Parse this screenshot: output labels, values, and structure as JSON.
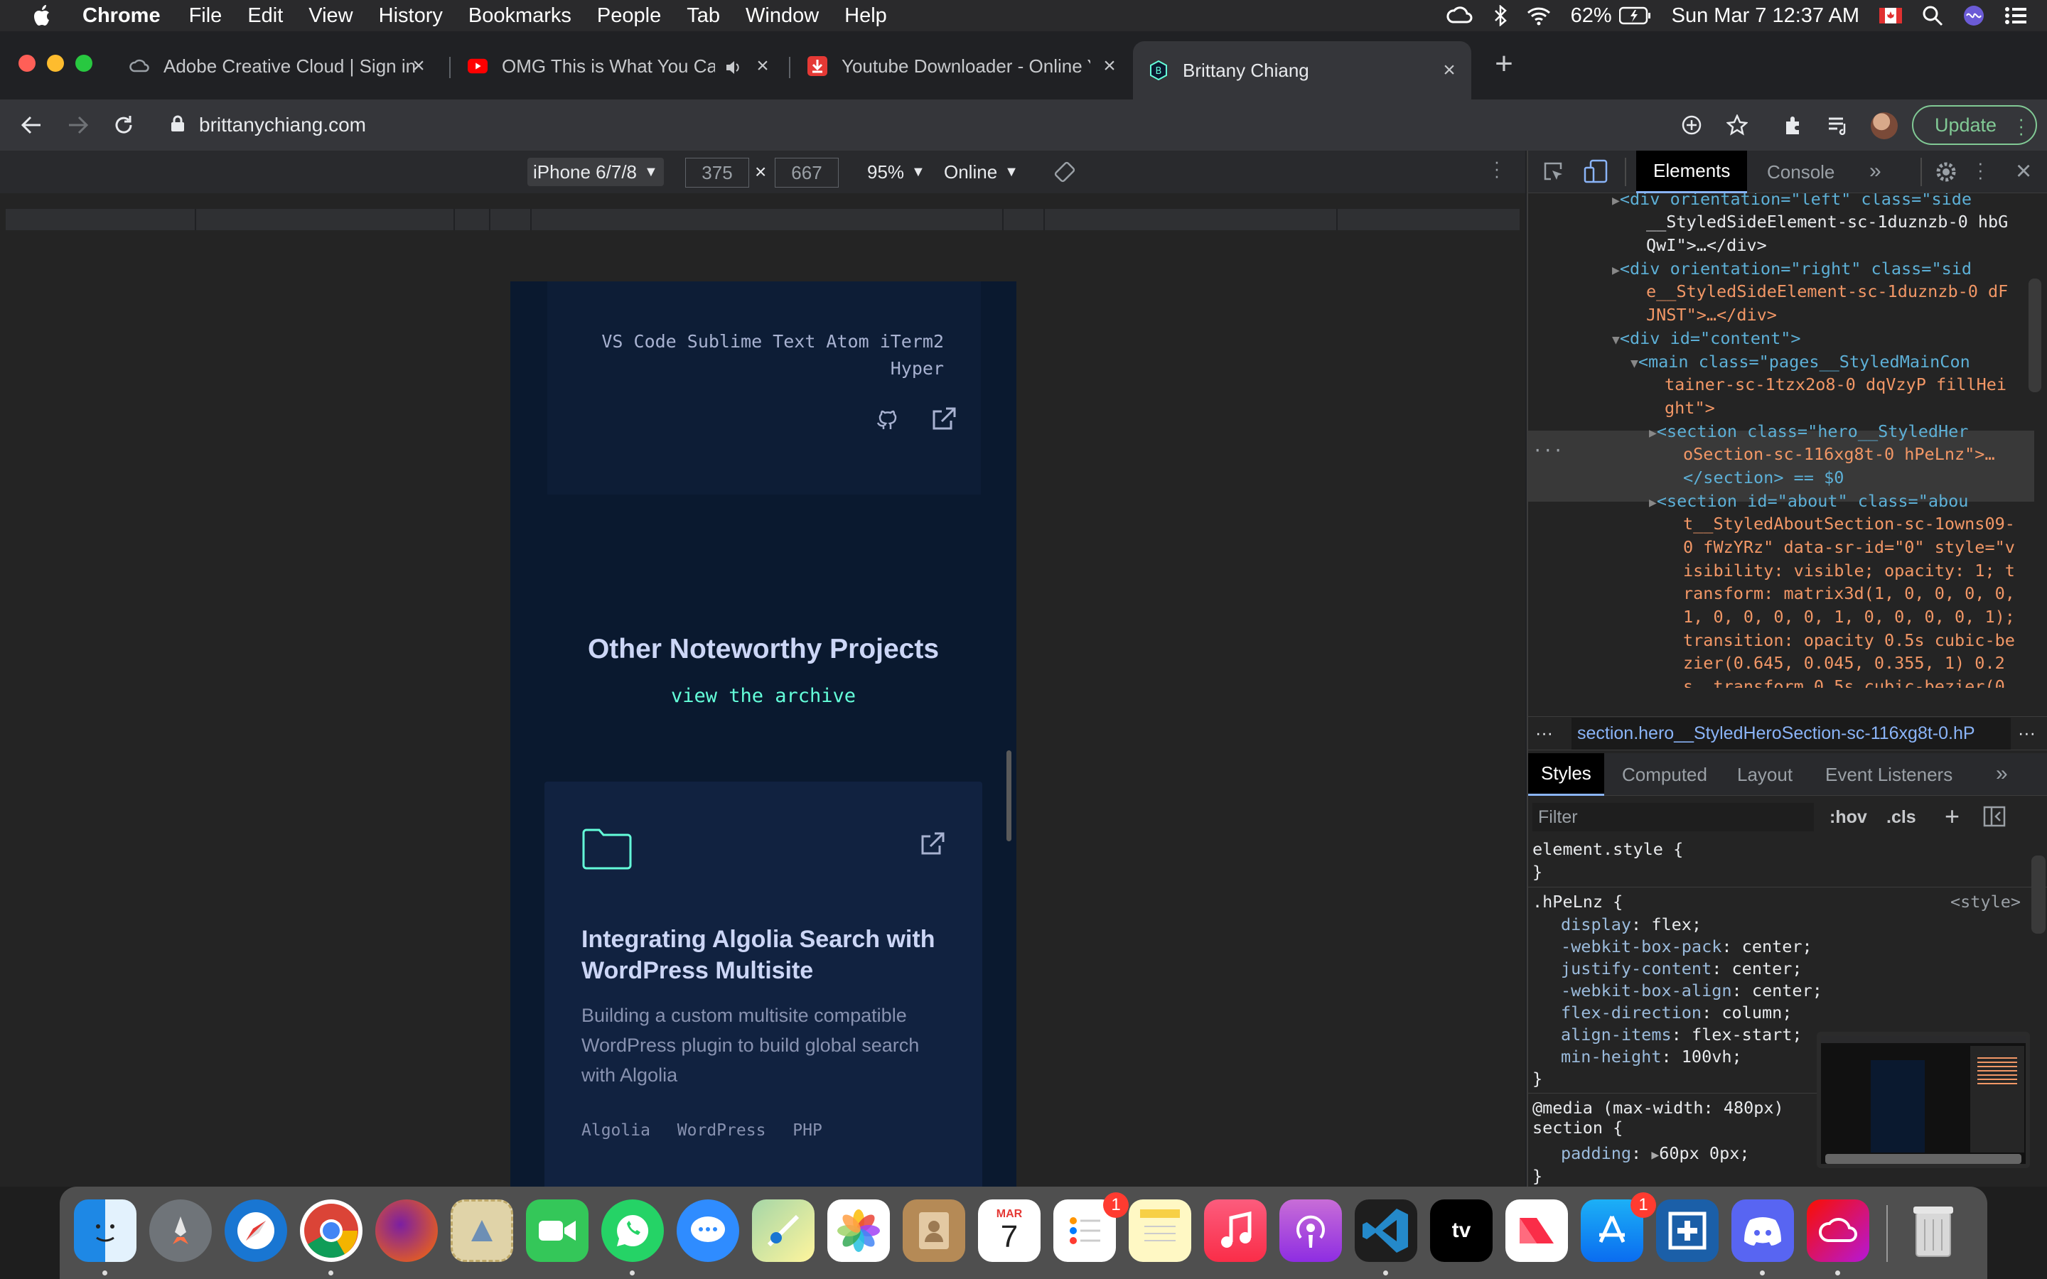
{
  "menubar": {
    "app": "Chrome",
    "items": [
      "File",
      "Edit",
      "View",
      "History",
      "Bookmarks",
      "People",
      "Tab",
      "Window",
      "Help"
    ],
    "battery": "62%",
    "clock": "Sun Mar 7  12:37 AM"
  },
  "tabs": [
    {
      "title": "Adobe Creative Cloud | Sign in",
      "favicon": "creative-cloud-icon"
    },
    {
      "title": "OMG This is What You Call",
      "favicon": "youtube-icon"
    },
    {
      "title": "Youtube Downloader - Online Y",
      "favicon": "download-icon"
    },
    {
      "title": "Brittany Chiang",
      "favicon": "b-logo-icon",
      "active": true
    }
  ],
  "omnibox": {
    "url": "brittanychiang.com"
  },
  "toolbar": {
    "update_label": "Update"
  },
  "device_toolbar": {
    "device": "iPhone 6/7/8",
    "width": "375",
    "height": "667",
    "zoom": "95%",
    "throttle": "Online"
  },
  "page": {
    "tech_list": "VS Code  Sublime Text  Atom  iTerm2  Hyper",
    "section_title": "Other Noteworthy Projects",
    "archive_link": "view the archive",
    "project": {
      "title": "Integrating Algolia Search with WordPress Multisite",
      "description": "Building a custom multisite compatible WordPress plugin to build global search with Algolia",
      "tags": [
        "Algolia",
        "WordPress",
        "PHP"
      ]
    }
  },
  "devtools": {
    "tabs": [
      "Elements",
      "Console"
    ],
    "dom": [
      "<div orientation=\"left\" class=\"side",
      "__StyledSideElement-sc-1duznzb-0 hbG",
      "QwI\">…</div>",
      "<div orientation=\"right\" class=\"sid",
      "e__StyledSideElement-sc-1duznzb-0 dF",
      "JNST\">…</div>",
      "<div id=\"content\">",
      "<main class=\"pages__StyledMainCon",
      "tainer-sc-1tzx2o8-0 dqVzyP fillHei",
      "ght\">",
      "<section class=\"hero__StyledHer",
      "oSection-sc-116xg8t-0 hPeLnz\">…",
      "</section> == $0",
      "<section id=\"about\" class=\"abou",
      "t__StyledAboutSection-sc-1owns09-",
      "0 fWzYRz\" data-sr-id=\"0\" style=\"v",
      "isibility: visible; opacity: 1; t",
      "ransform: matrix3d(1, 0, 0, 0, 0,",
      "1, 0, 0, 0, 0, 1, 0, 0, 0, 0, 1);",
      "transition: opacity 0.5s cubic-be",
      "zier(0.645, 0.045, 0.355, 1) 0.2",
      "s, transform 0.5s cubic-bezier(0."
    ],
    "breadcrumb": "section.hero__StyledHeroSection-sc-116xg8t-0.hP",
    "styles_tabs": [
      "Styles",
      "Computed",
      "Layout",
      "Event Listeners"
    ],
    "filter_placeholder": "Filter",
    "hov": ":hov",
    "cls": ".cls",
    "css": {
      "element_style": "element.style {",
      "close": "}",
      "selector": ".hPeLnz {",
      "source": "<style>",
      "props": [
        [
          "display",
          "flex;"
        ],
        [
          "-webkit-box-pack",
          "center;"
        ],
        [
          "justify-content",
          "center;"
        ],
        [
          "-webkit-box-align",
          "center;"
        ],
        [
          "flex-direction",
          "column;"
        ],
        [
          "align-items",
          "flex-start;"
        ],
        [
          "min-height",
          "100vh;"
        ]
      ],
      "media": "@media (max-width: 480px)",
      "section_selector": "section {",
      "padding_prop": "padding",
      "padding_val": "60px 0px;"
    }
  },
  "dock": {
    "apps": [
      "Finder",
      "Launchpad",
      "Safari",
      "Chrome",
      "Firefox",
      "Preview",
      "FaceTime",
      "WhatsApp",
      "Messages",
      "Maps",
      "Photos",
      "Contacts",
      "Calendar",
      "Reminders",
      "Notes",
      "Music",
      "Podcasts",
      "VS Code",
      "TV",
      "News",
      "App Store",
      "Screen Capture",
      "Discord",
      "Creative Cloud",
      "Trash"
    ],
    "calendar_month": "MAR",
    "calendar_day": "7",
    "badges": {
      "reminders": "1",
      "app_store": "1"
    },
    "tv_label": "tv"
  }
}
